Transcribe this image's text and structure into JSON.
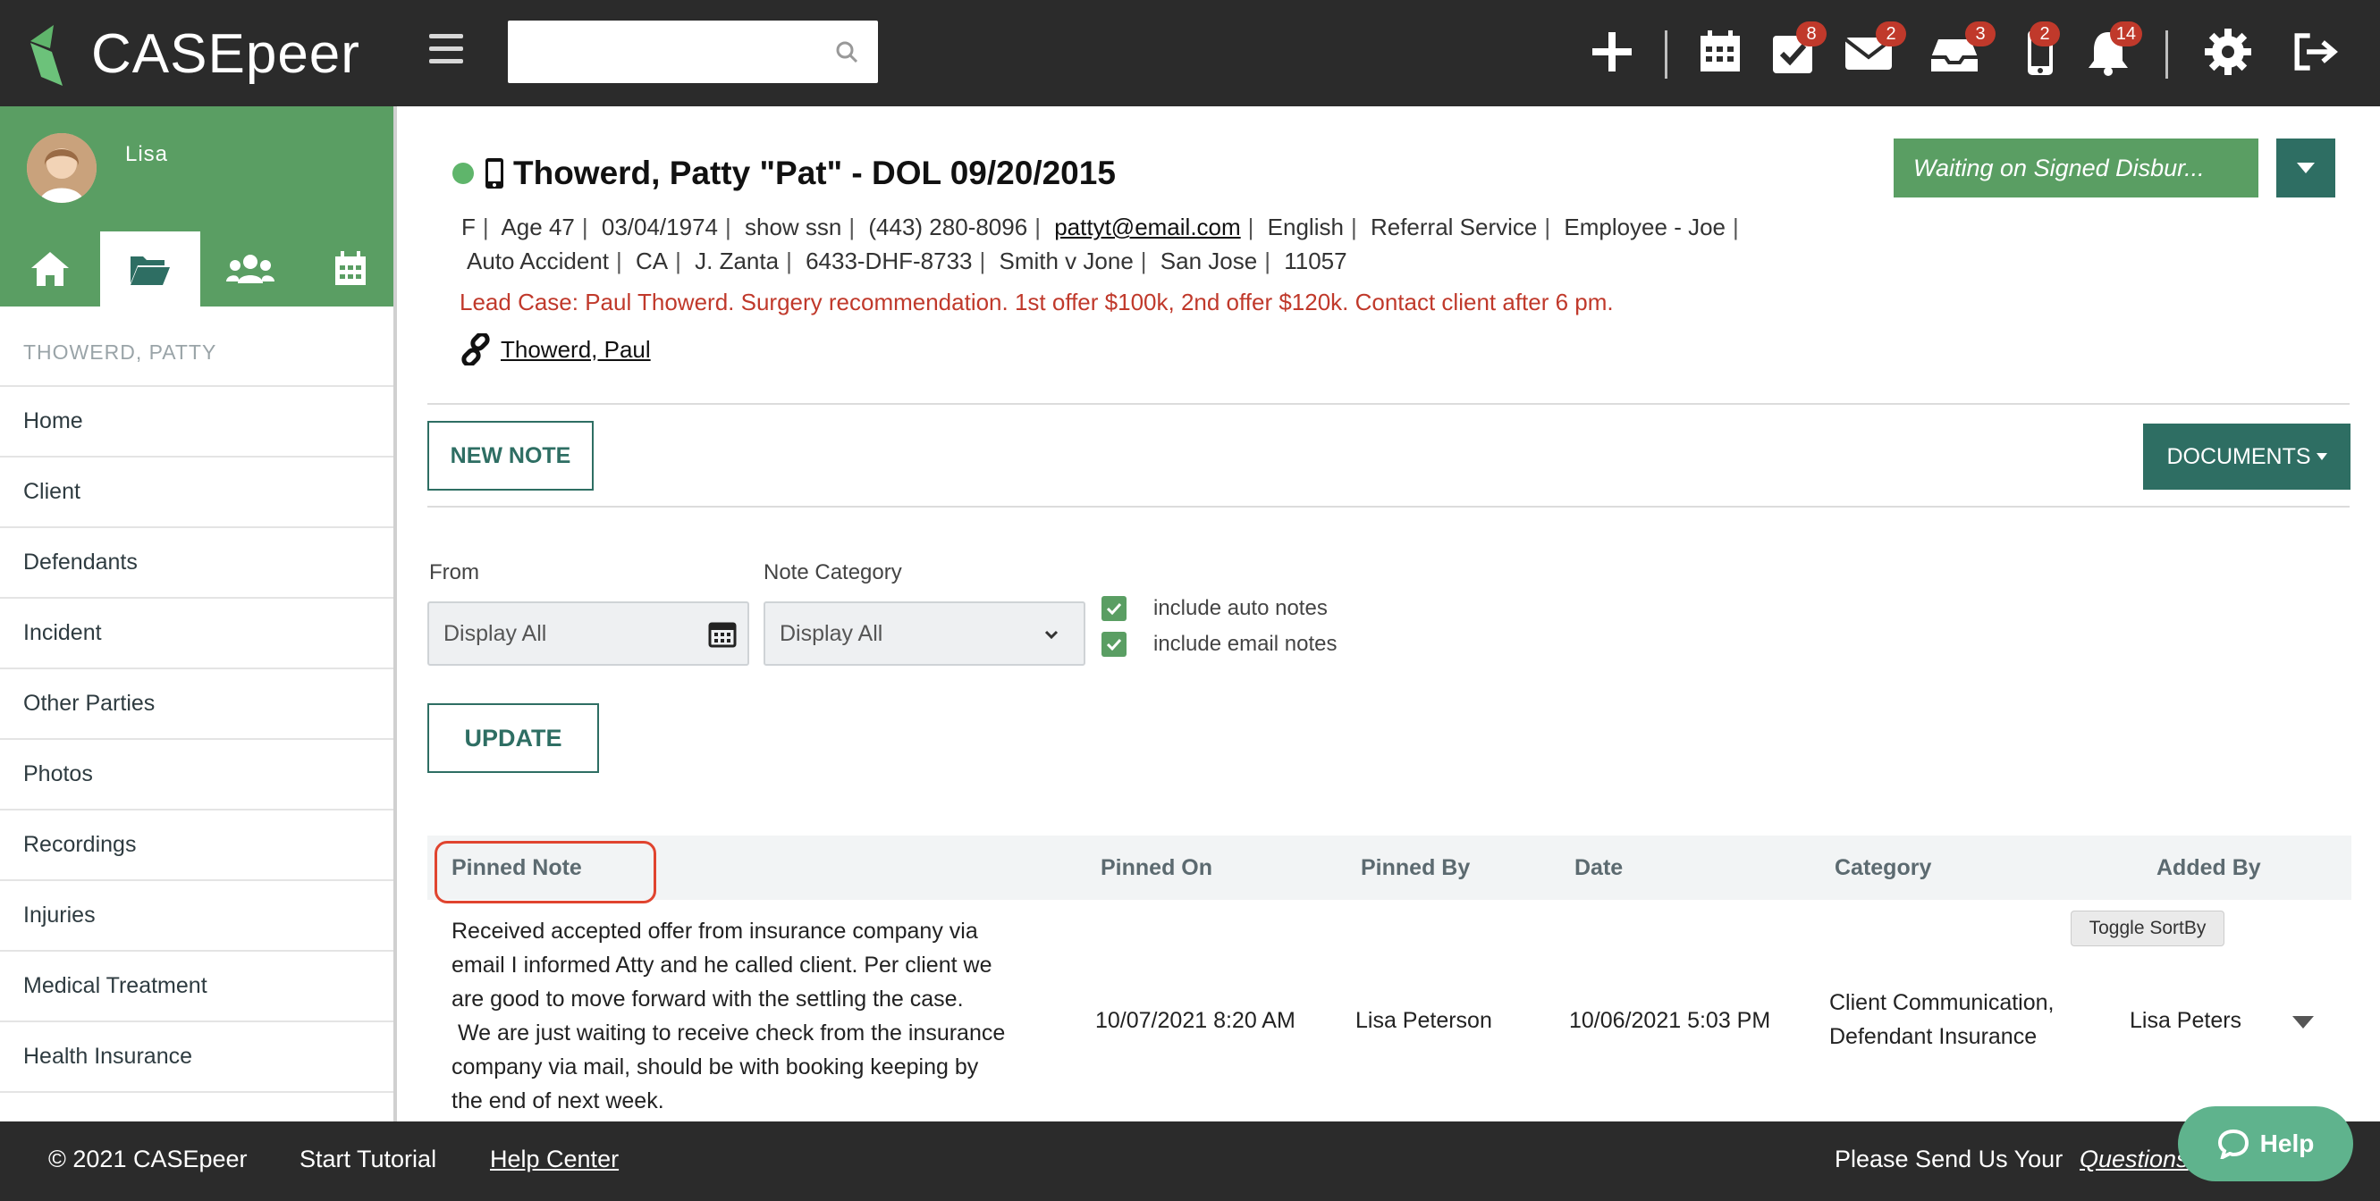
{
  "brand": {
    "name": "CASEpeer"
  },
  "search": {
    "placeholder": "",
    "value": ""
  },
  "toolbar": {
    "tasks_badge": "8",
    "mail_badge": "2",
    "inbox_badge": "3",
    "phone_badge": "2",
    "bell_badge": "14"
  },
  "sidebar": {
    "user_name": "Lisa",
    "case_header": "THOWERD, PATTY",
    "items": [
      "Home",
      "Client",
      "Defendants",
      "Incident",
      "Other Parties",
      "Photos",
      "Recordings",
      "Injuries",
      "Medical Treatment",
      "Health Insurance"
    ]
  },
  "case": {
    "status": "Waiting on Signed Disbur...",
    "title": "Thowerd, Patty \"Pat\" - DOL 09/20/2015",
    "line1": [
      "F",
      "Age 47",
      "03/04/1974",
      "show ssn",
      "(443) 280-8096",
      "pattyt@email.com",
      "English",
      "Referral Service",
      "Employee - Joe"
    ],
    "line2": [
      "Auto Accident",
      "CA",
      "J. Zanta",
      "6433-DHF-8733",
      "Smith v Jone",
      "San Jose",
      "11057"
    ],
    "lead": "Lead Case: Paul Thowerd. Surgery recommendation. 1st offer $100k, 2nd offer $120k. Contact client after 6 pm.",
    "linked_case": "Thowerd, Paul"
  },
  "notes": {
    "new_note_label": "NEW NOTE",
    "documents_label": "DOCUMENTS",
    "from_label": "From",
    "from_value": "Display All",
    "category_label": "Note Category",
    "category_value": "Display All",
    "auto_notes_label": "include auto notes",
    "email_notes_label": "include email notes",
    "update_label": "UPDATE",
    "columns": [
      "Pinned Note",
      "Pinned On",
      "Pinned By",
      "Date",
      "Category",
      "Added By"
    ],
    "tooltip": "Toggle SortBy",
    "rows": [
      {
        "note_lines": [
          "Received accepted offer from insurance company via",
          "email I informed Atty and he called client.  Per client we",
          "are good to move forward with the settling the case.",
          " We are just waiting to receive check from the insurance",
          "company via mail, should be with booking keeping by",
          "the end of next week."
        ],
        "pinned_on": "10/07/2021 8:20 AM",
        "pinned_by": "Lisa Peterson",
        "date": "10/06/2021 5:03 PM",
        "category_lines": [
          "Client Communication,",
          "Defendant Insurance"
        ],
        "added_by": "Lisa Peters"
      }
    ]
  },
  "footer": {
    "copyright": "© 2021 CASEpeer",
    "tutorial": "Start Tutorial",
    "help_center": "Help Center",
    "questions_prefix": "Please Send Us Your",
    "questions_link": "Questions",
    "help_button": "Help"
  },
  "colors": {
    "topbar": "#2b2b2b",
    "brand_green": "#5a9e63",
    "teal": "#2e6e63",
    "alert_red": "#c0392b"
  }
}
